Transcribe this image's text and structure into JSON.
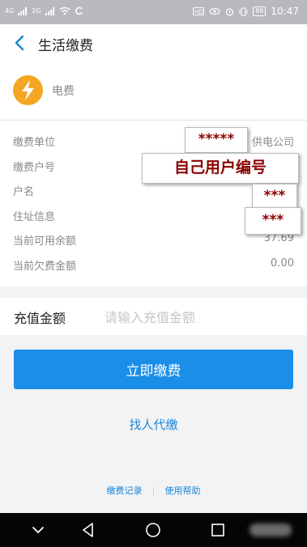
{
  "status_bar": {
    "signal_left": "4G",
    "signal_right": "2G",
    "battery": "88",
    "time": "10:47"
  },
  "header": {
    "back_icon": "chevron-left-icon",
    "title": "生活缴费"
  },
  "bill": {
    "icon": "lightning-bolt-icon",
    "type_label": "电费",
    "rows": [
      {
        "label": "缴费单位",
        "value": "供电公司"
      },
      {
        "label": "缴费户号",
        "value": ""
      },
      {
        "label": "户名",
        "value": ""
      },
      {
        "label": "住址信息",
        "value": ""
      },
      {
        "label": "当前可用余额",
        "value": "37.69"
      },
      {
        "label": "当前欠费金额",
        "value": "0.00"
      }
    ]
  },
  "overlays": {
    "unit_mask": "*****",
    "account_note": "自己用户编号",
    "name_mask": "***",
    "address_mask": "***"
  },
  "recharge": {
    "label": "充值金额",
    "placeholder": "请输入充值金额",
    "value": ""
  },
  "actions": {
    "pay_label": "立即缴费",
    "proxy_label": "找人代缴",
    "history_label": "缴费记录",
    "help_label": "使用帮助"
  },
  "colors": {
    "accent": "#1b8ee8",
    "link": "#1a86d8",
    "bolt": "#f5a623",
    "overlay_text": "#8b0000"
  },
  "nav_bar": {
    "back_icon": "triangle-back-icon",
    "home_icon": "circle-home-icon",
    "recents_icon": "square-recents-icon",
    "collapse_icon": "chevron-down-icon"
  }
}
